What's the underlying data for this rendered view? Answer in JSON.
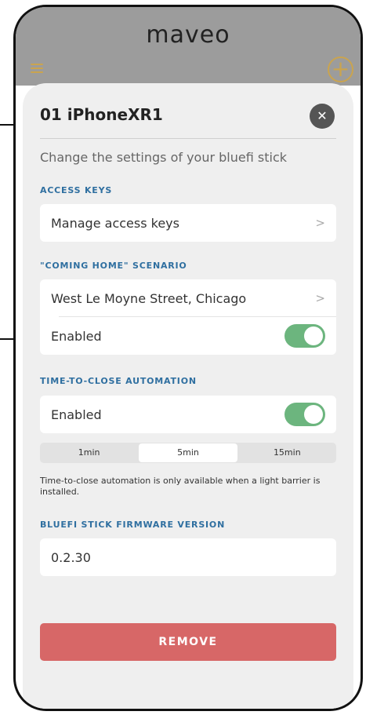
{
  "app": {
    "logo_text": "maveo"
  },
  "header": {
    "menu_icon": "hamburger-menu-icon",
    "add_icon": "plus-circle-icon"
  },
  "dialog": {
    "title": "01 iPhoneXR1",
    "close_icon": "close-x-icon",
    "subtitle": "Change the settings of your bluefi stick"
  },
  "access_keys": {
    "section_label": "ACCESS KEYS",
    "manage_label": "Manage access keys",
    "chevron": ">"
  },
  "coming_home": {
    "section_label": "\"COMING HOME\" SCENARIO",
    "location": "West Le Moyne Street, Chicago",
    "chevron": ">",
    "enabled_label": "Enabled",
    "enabled": true
  },
  "time_to_close": {
    "section_label": "TIME-TO-CLOSE AUTOMATION",
    "enabled_label": "Enabled",
    "enabled": true,
    "options": [
      "1min",
      "5min",
      "15min"
    ],
    "selected": "5min",
    "note": "Time-to-close automation is only available when a light barrier is installed."
  },
  "firmware": {
    "section_label": "BLUEFI STICK FIRMWARE VERSION",
    "version": "0.2.30"
  },
  "actions": {
    "remove_label": "REMOVE"
  },
  "colors": {
    "accent_gold": "#caa44f",
    "section_blue": "#2f6fa0",
    "toggle_green": "#6cb57e",
    "remove_red": "#d76767",
    "close_button": "#555555"
  }
}
